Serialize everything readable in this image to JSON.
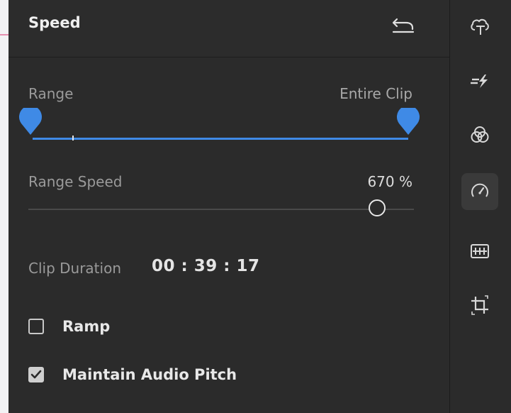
{
  "panel": {
    "title": "Speed",
    "reset_icon": "undo-icon"
  },
  "range": {
    "label": "Range",
    "value": "Entire Clip",
    "start_fraction": 0.0,
    "end_fraction": 1.0,
    "accent_color": "#3f8ae6"
  },
  "range_speed": {
    "label": "Range Speed",
    "value": "670 %",
    "slider_fraction": 0.9
  },
  "clip_duration": {
    "label": "Clip Duration",
    "value": "00 : 39 : 17"
  },
  "options": {
    "ramp": {
      "label": "Ramp",
      "checked": false
    },
    "maintain_audio_pitch": {
      "label": "Maintain Audio Pitch",
      "checked": true
    }
  },
  "rail": {
    "items": [
      {
        "icon": "titles-icon",
        "active": false
      },
      {
        "icon": "effects-icon",
        "active": false
      },
      {
        "icon": "color-icon",
        "active": false
      },
      {
        "icon": "speed-icon",
        "active": true
      },
      {
        "icon": "audio-icon",
        "active": false
      },
      {
        "icon": "crop-icon",
        "active": false
      }
    ]
  }
}
